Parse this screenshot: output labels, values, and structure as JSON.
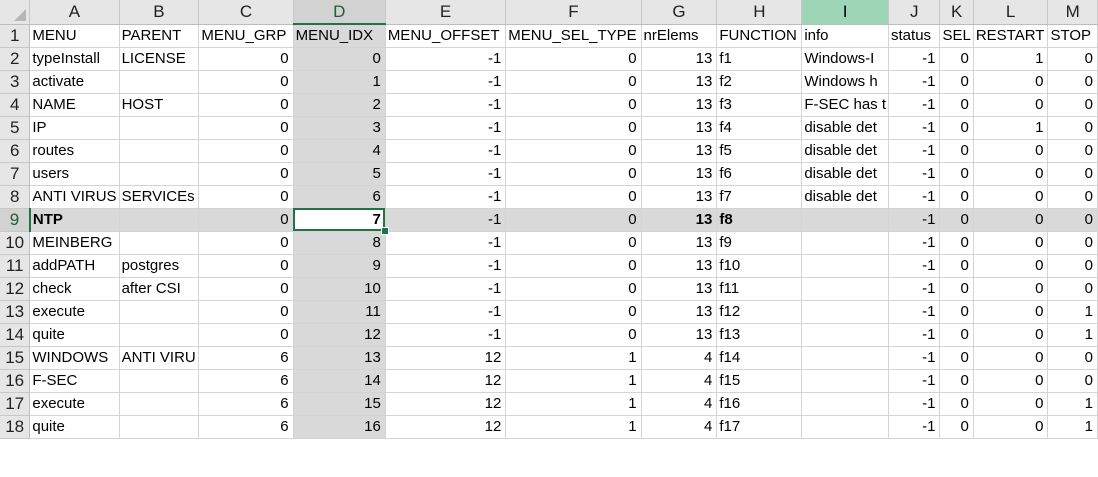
{
  "columns": [
    "A",
    "B",
    "C",
    "D",
    "E",
    "F",
    "G",
    "H",
    "I",
    "J",
    "K",
    "L",
    "M"
  ],
  "selected_row": 9,
  "active_cell": "D9",
  "rows": [
    {
      "n": "1",
      "cells": [
        "MENU",
        "PARENT",
        "MENU_GRP",
        "MENU_IDX",
        "MENU_OFFSET",
        "MENU_SEL_TYPE",
        "nrElems",
        "FUNCTION",
        "info",
        "status",
        "SEL",
        "RESTART",
        "STOP"
      ]
    },
    {
      "n": "2",
      "cells": [
        "typeInstall",
        "LICENSE",
        "0",
        "0",
        "-1",
        "0",
        "13",
        "f1",
        "Windows-I",
        "-1",
        "0",
        "1",
        "0"
      ]
    },
    {
      "n": "3",
      "cells": [
        "activate",
        "",
        "0",
        "1",
        "-1",
        "0",
        "13",
        "f2",
        "Windows h",
        "-1",
        "0",
        "0",
        "0"
      ]
    },
    {
      "n": "4",
      "cells": [
        "NAME",
        "HOST",
        "0",
        "2",
        "-1",
        "0",
        "13",
        "f3",
        "F-SEC has t",
        "-1",
        "0",
        "0",
        "0"
      ]
    },
    {
      "n": "5",
      "cells": [
        "IP",
        "",
        "0",
        "3",
        "-1",
        "0",
        "13",
        "f4",
        "disable det",
        "-1",
        "0",
        "1",
        "0"
      ]
    },
    {
      "n": "6",
      "cells": [
        "routes",
        "",
        "0",
        "4",
        "-1",
        "0",
        "13",
        "f5",
        "disable det",
        "-1",
        "0",
        "0",
        "0"
      ]
    },
    {
      "n": "7",
      "cells": [
        "users",
        "",
        "0",
        "5",
        "-1",
        "0",
        "13",
        "f6",
        "disable det",
        "-1",
        "0",
        "0",
        "0"
      ]
    },
    {
      "n": "8",
      "cells": [
        "ANTI VIRUS",
        "SERVICEs",
        "0",
        "6",
        "-1",
        "0",
        "13",
        "f7",
        "disable det",
        "-1",
        "0",
        "0",
        "0"
      ]
    },
    {
      "n": "9",
      "cells": [
        "NTP",
        "",
        "0",
        "7",
        "-1",
        "0",
        "13",
        "f8",
        "",
        "-1",
        "0",
        "0",
        "0"
      ]
    },
    {
      "n": "10",
      "cells": [
        "MEINBERG",
        "",
        "0",
        "8",
        "-1",
        "0",
        "13",
        "f9",
        "",
        "-1",
        "0",
        "0",
        "0"
      ]
    },
    {
      "n": "11",
      "cells": [
        "addPATH",
        "postgres",
        "0",
        "9",
        "-1",
        "0",
        "13",
        "f10",
        "",
        "-1",
        "0",
        "0",
        "0"
      ]
    },
    {
      "n": "12",
      "cells": [
        "check",
        "after CSI",
        "0",
        "10",
        "-1",
        "0",
        "13",
        "f11",
        "",
        "-1",
        "0",
        "0",
        "0"
      ]
    },
    {
      "n": "13",
      "cells": [
        "execute",
        "",
        "0",
        "11",
        "-1",
        "0",
        "13",
        "f12",
        "",
        "-1",
        "0",
        "0",
        "1"
      ]
    },
    {
      "n": "14",
      "cells": [
        "quite",
        "",
        "0",
        "12",
        "-1",
        "0",
        "13",
        "f13",
        "",
        "-1",
        "0",
        "0",
        "1"
      ]
    },
    {
      "n": "15",
      "cells": [
        "WINDOWS",
        "ANTI VIRU",
        "6",
        "13",
        "12",
        "1",
        "4",
        "f14",
        "",
        "-1",
        "0",
        "0",
        "0"
      ]
    },
    {
      "n": "16",
      "cells": [
        "F-SEC",
        "",
        "6",
        "14",
        "12",
        "1",
        "4",
        "f15",
        "",
        "-1",
        "0",
        "0",
        "0"
      ]
    },
    {
      "n": "17",
      "cells": [
        "execute",
        "",
        "6",
        "15",
        "12",
        "1",
        "4",
        "f16",
        "",
        "-1",
        "0",
        "0",
        "1"
      ]
    },
    {
      "n": "18",
      "cells": [
        "quite",
        "",
        "6",
        "16",
        "12",
        "1",
        "4",
        "f17",
        "",
        "-1",
        "0",
        "0",
        "1"
      ]
    }
  ]
}
